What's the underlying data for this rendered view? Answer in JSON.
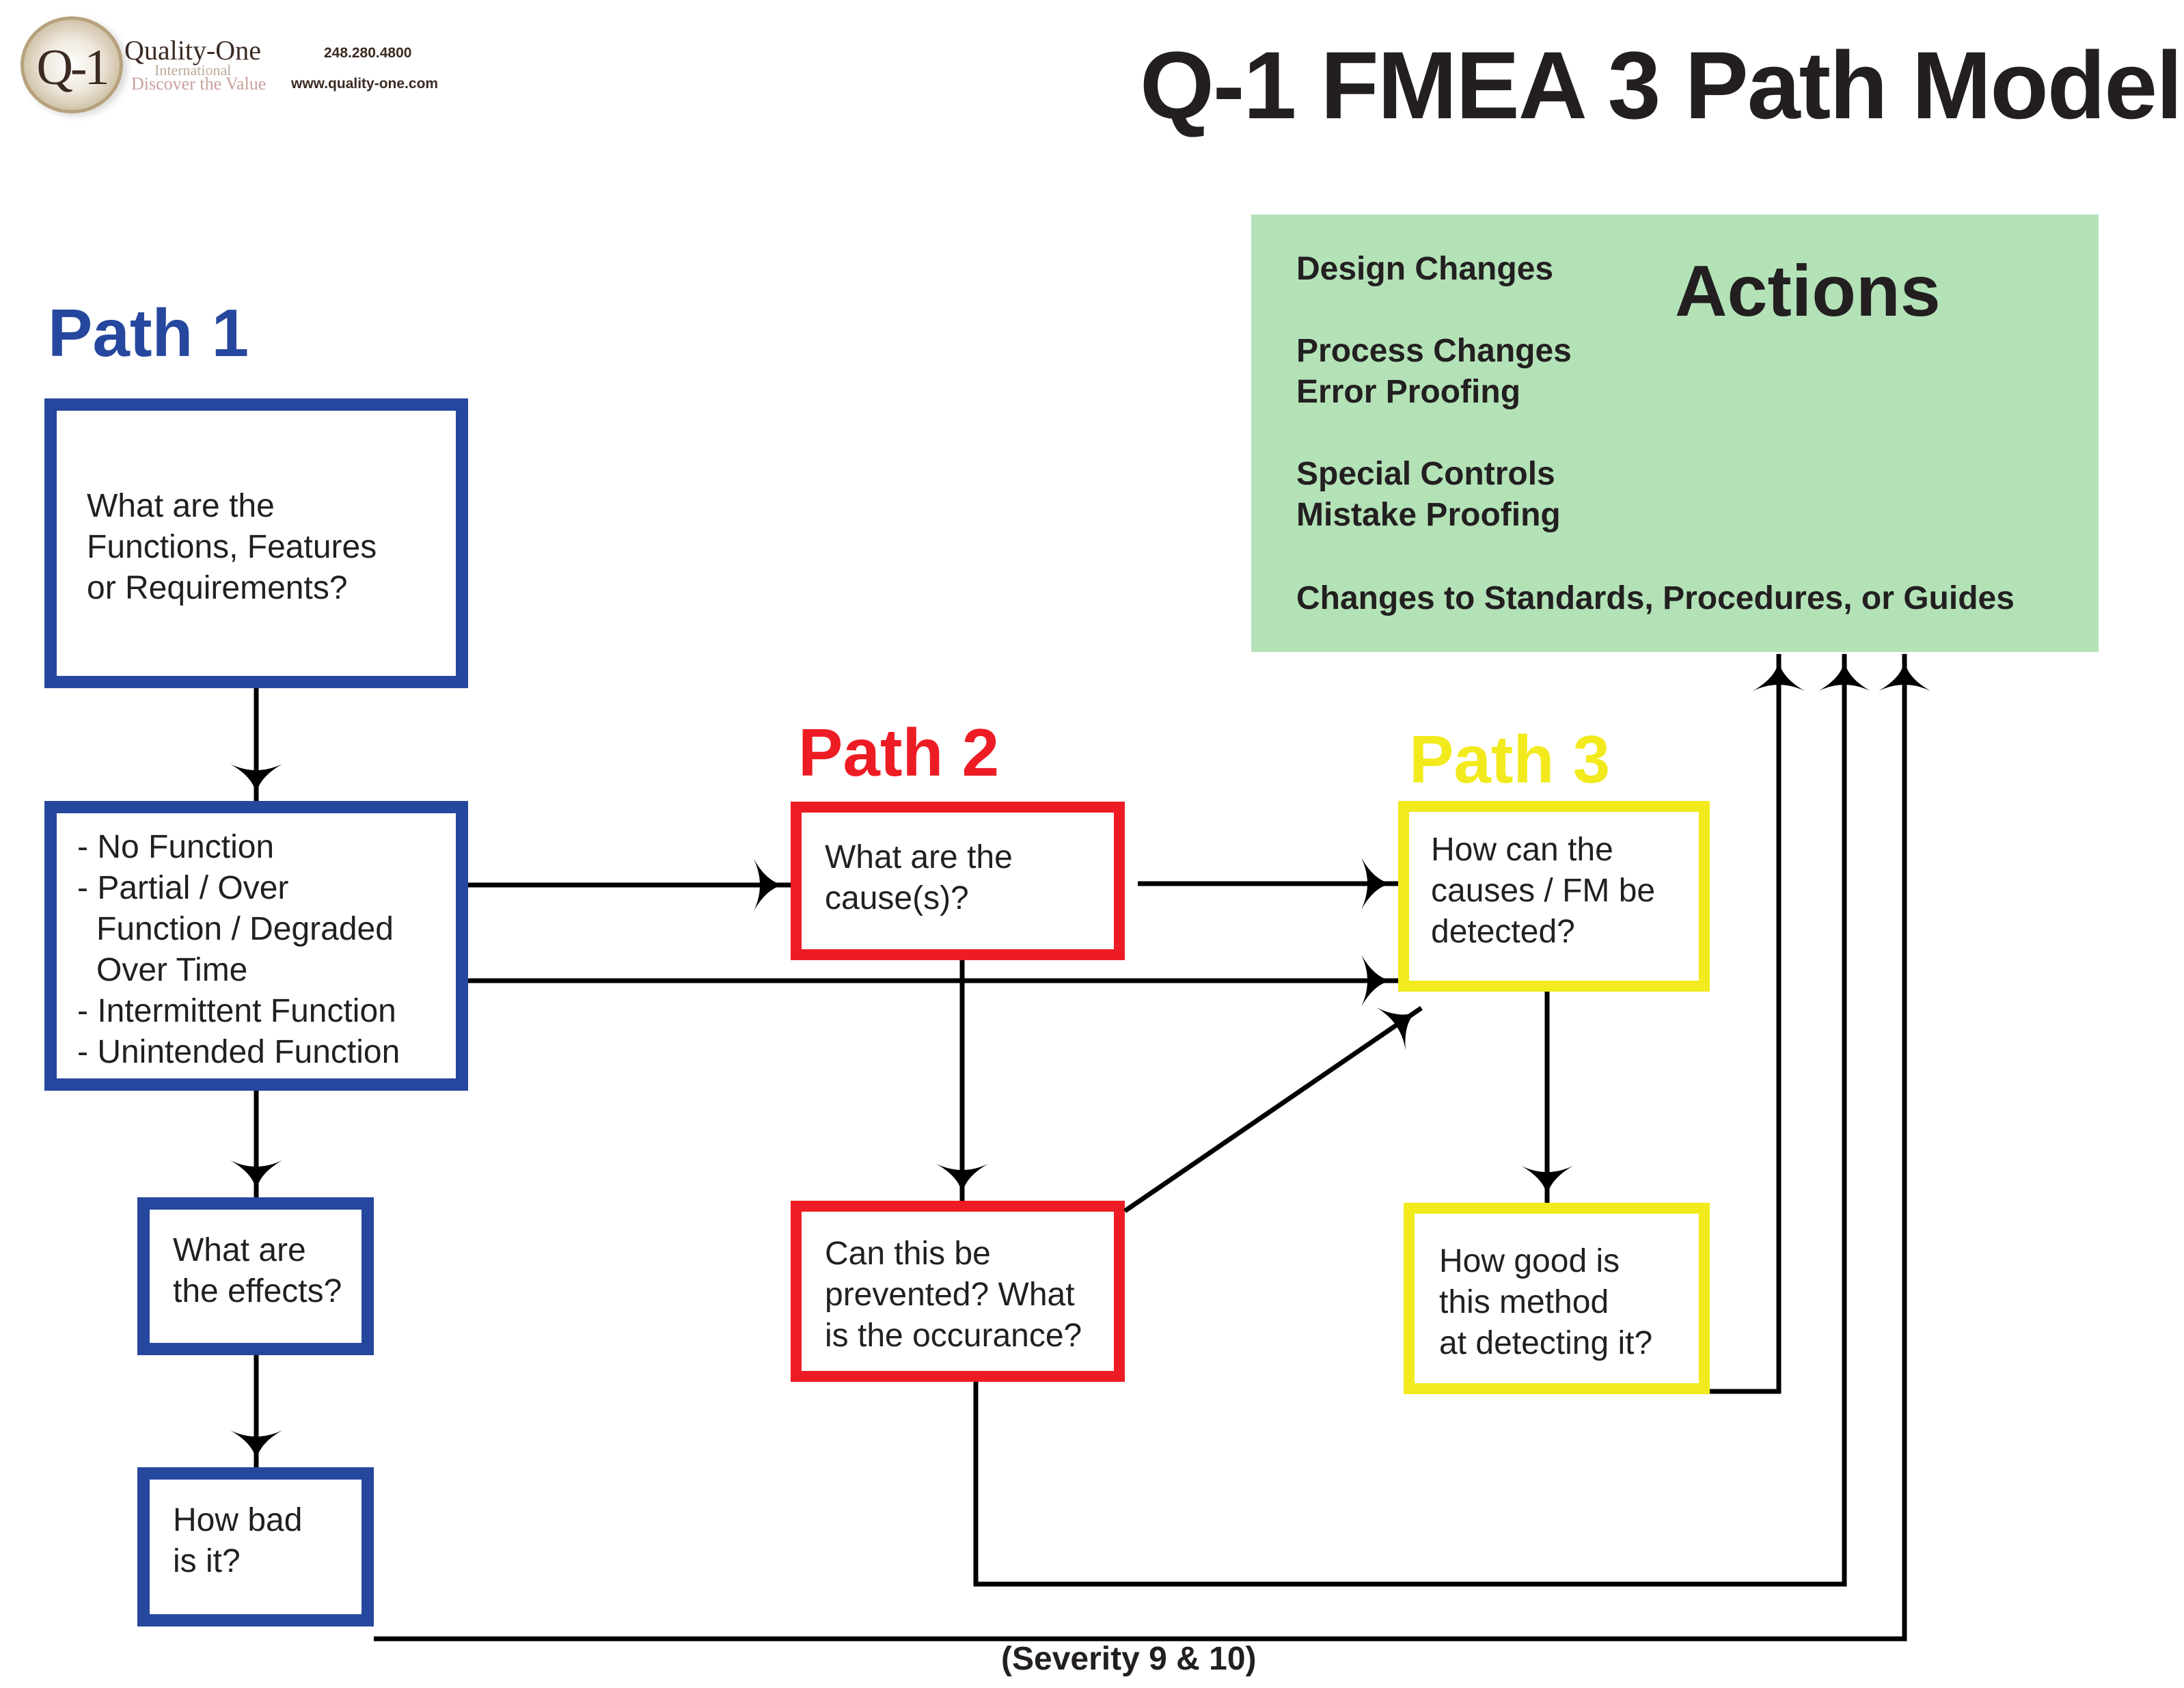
{
  "header": {
    "logo_mark": "Q-1",
    "brand_name": "Quality-One",
    "brand_sub": "International",
    "brand_tagline": "Discover the Value",
    "phone": "248.280.4800",
    "website": "www.quality-one.com",
    "title": "Q-1 FMEA 3 Path Model"
  },
  "colors": {
    "path1": "#26479e",
    "path2": "#ed1c24",
    "path3": "#f2ea1c",
    "actions_bg": "#b3e2b7",
    "arrow": "#000000"
  },
  "actions": {
    "title": "Actions",
    "items": [
      "Design Changes",
      "Process Changes",
      "Error Proofing",
      "Special Controls",
      "Mistake Proofing",
      "Changes to Standards, Procedures, or Guides"
    ]
  },
  "paths": [
    {
      "label": "Path 1",
      "boxes": [
        {
          "id": "functions",
          "lines": [
            "What are the",
            "Functions, Features",
            "or Requirements?"
          ]
        },
        {
          "id": "failure-modes",
          "lines": [
            "- No Function",
            "- Partial / Over",
            "  Function / Degraded",
            "  Over Time",
            "- Intermittent Function",
            "- Unintended Function"
          ]
        },
        {
          "id": "effects",
          "lines": [
            "What are",
            "the effects?"
          ]
        },
        {
          "id": "severity",
          "lines": [
            "How bad",
            "is it?"
          ]
        }
      ]
    },
    {
      "label": "Path 2",
      "boxes": [
        {
          "id": "causes",
          "lines": [
            "What are the",
            "cause(s)?"
          ]
        },
        {
          "id": "prevention",
          "lines": [
            "Can this be",
            "prevented? What",
            "is the occurance?"
          ]
        }
      ]
    },
    {
      "label": "Path 3",
      "boxes": [
        {
          "id": "detection",
          "lines": [
            "How can the",
            "causes / FM be",
            "detected?"
          ]
        },
        {
          "id": "detection-rating",
          "lines": [
            "How good is",
            "this method",
            "at detecting it?"
          ]
        }
      ]
    }
  ],
  "footnote": "(Severity 9 & 10)"
}
